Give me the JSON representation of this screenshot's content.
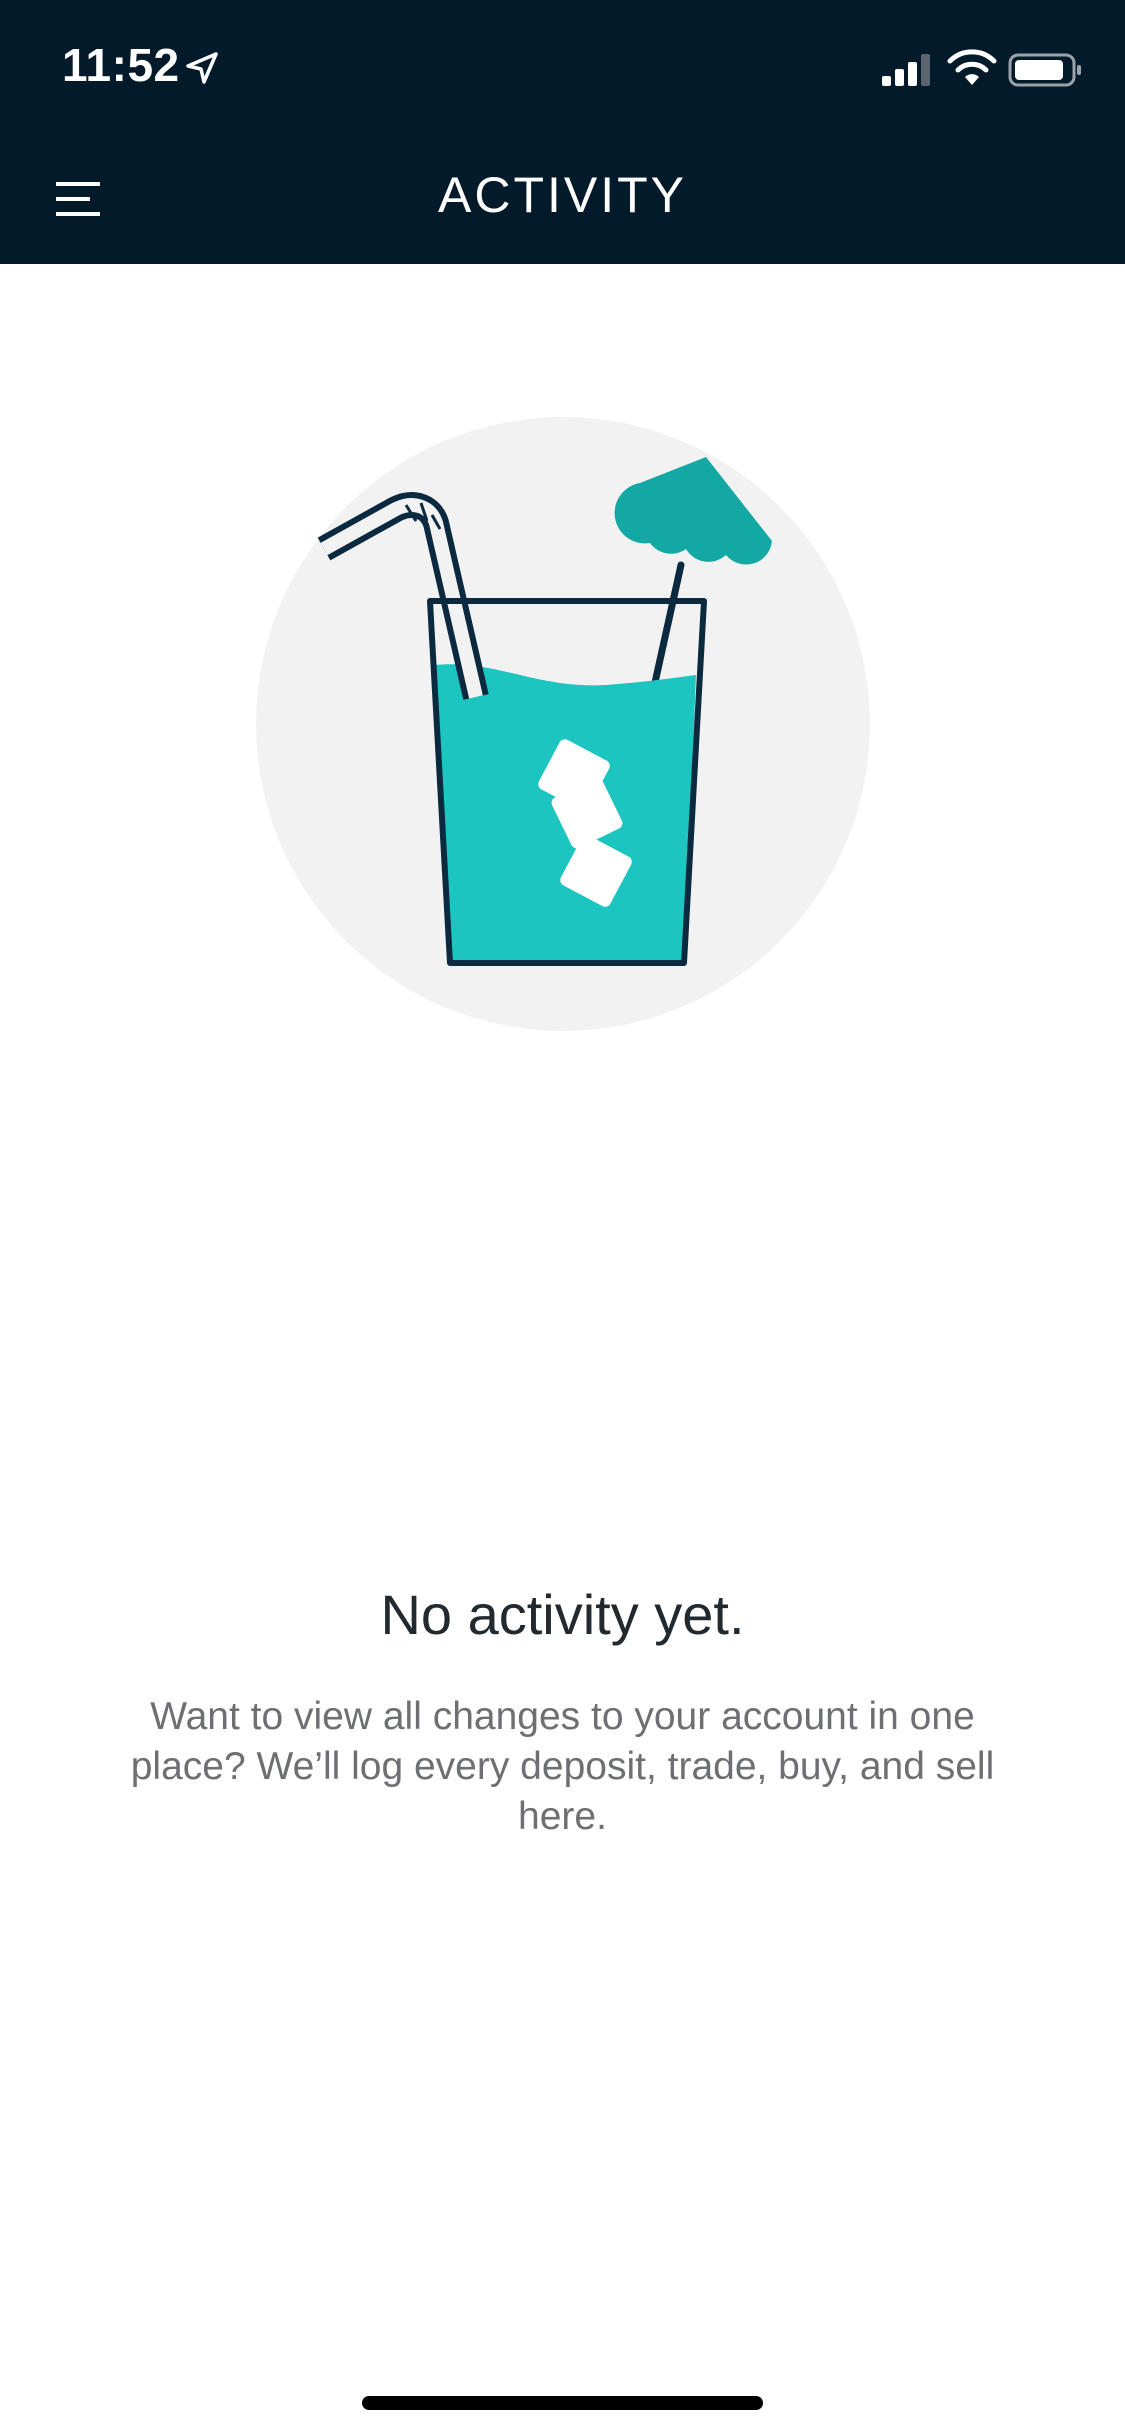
{
  "status_bar": {
    "time": "11:52",
    "icons": [
      "location-arrow-icon",
      "cellular-signal-icon",
      "wifi-icon",
      "battery-icon"
    ]
  },
  "header": {
    "title": "ACTIVITY",
    "menu_icon": "hamburger-menu-icon",
    "background_color": "#031a2a"
  },
  "empty_state": {
    "illustration": "drink-glass-illustration",
    "title": "No activity yet.",
    "description": "Want to view all changes to your account in one place? We’ll log every deposit, trade, buy, and sell here."
  },
  "colors": {
    "accent": "#1cc5c0",
    "umbrella": "#13a8a4",
    "illustration_bg": "#f2f2f2",
    "outline": "#0c2a3f"
  }
}
